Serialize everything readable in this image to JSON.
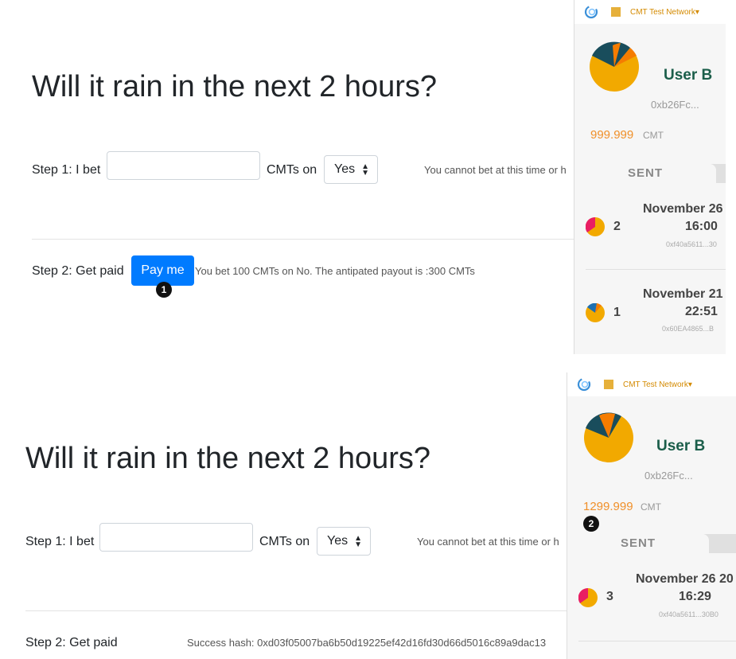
{
  "top": {
    "question": "Will it rain in the next 2 hours?",
    "step1_label": "Step 1: I bet",
    "bet_input_value": "",
    "cmts_on": "CMTs on",
    "select_value": "Yes",
    "cannot_bet": "You cannot bet at this time or h",
    "step2_label": "Step 2: Get paid",
    "pay_button": "Pay me",
    "bet_info": "You bet 100 CMTs on No. The antipated payout is :300 CMTs",
    "badge": "1"
  },
  "bottom": {
    "question": "Will it rain in the next 2 hours?",
    "step1_label": "Step 1: I bet",
    "bet_input_value": "",
    "cmts_on": "CMTs on",
    "select_value": "Yes",
    "cannot_bet": "You cannot bet at this time or h",
    "step2_label": "Step 2: Get paid",
    "success": "Success hash: 0xd03f05007ba6b50d19225ef42d16fd30d66d5016c89a9dac13"
  },
  "wallet_top": {
    "network": "CMT Test Network",
    "user": "User B",
    "address": "0xb26Fc...",
    "balance": "999.999",
    "currency": "CMT",
    "tab_sent": "SENT",
    "txs": [
      {
        "date_line1": "November 26",
        "date_line2": "16:00",
        "count": "2",
        "address": "0xf40a5611...30"
      },
      {
        "date_line1": "November 21",
        "date_line2": "22:51",
        "count": "1",
        "address": "0x60EA4865...B"
      }
    ]
  },
  "wallet_bottom": {
    "network": "CMT Test Network",
    "user": "User B",
    "address": "0xb26Fc...",
    "balance": "1299.999",
    "currency": "CMT",
    "badge": "2",
    "tab_sent": "SENT",
    "txs": [
      {
        "date_line1": "November 26 20",
        "date_line2": "16:29",
        "count": "3",
        "address": "0xf40a5611...30B0"
      }
    ]
  }
}
